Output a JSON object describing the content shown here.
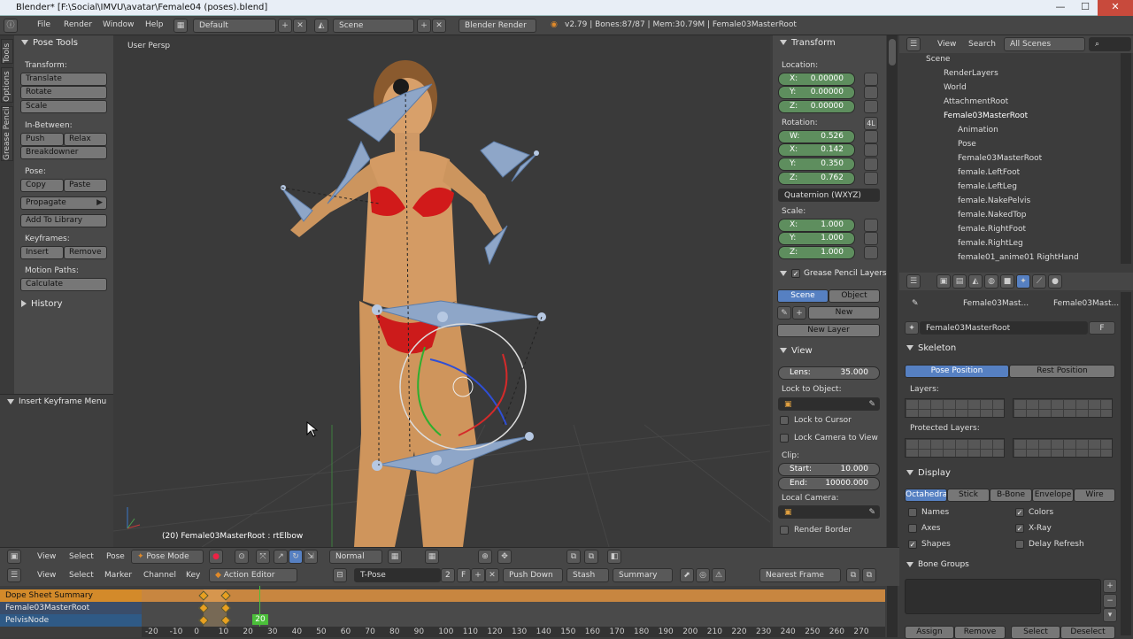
{
  "window": {
    "title": "Blender* [F:\\Social\\IMVU\\avatar\\Female04 (poses).blend]",
    "min": "—",
    "max": "☐",
    "close": "✕"
  },
  "menu": {
    "items": [
      "File",
      "Render",
      "Window",
      "Help"
    ],
    "layout": "Default",
    "scene": "Scene",
    "engine": "Blender Render",
    "stats": "v2.79 | Bones:87/87 | Mem:30.79M | Female03MasterRoot"
  },
  "tool_shelf": {
    "tabs": [
      "Tools",
      "Options",
      "Grease Pencil"
    ],
    "title": "Pose Tools",
    "transform_label": "Transform:",
    "translate": "Translate",
    "rotate": "Rotate",
    "scale": "Scale",
    "inbetween_label": "In-Between:",
    "push": "Push",
    "relax": "Relax",
    "breakdowner": "Breakdowner",
    "pose_label": "Pose:",
    "copy": "Copy",
    "paste": "Paste",
    "propagate": "Propagate",
    "add_to_library": "Add To Library",
    "keyframes_label": "Keyframes:",
    "insert": "Insert",
    "remove": "Remove",
    "motion_paths_label": "Motion Paths:",
    "calculate": "Calculate",
    "history": "History",
    "operator_panel": "Insert Keyframe Menu"
  },
  "viewport": {
    "label": "User Persp",
    "status": "(20) Female03MasterRoot : rtElbow"
  },
  "n_panel": {
    "transform_title": "Transform",
    "location_label": "Location:",
    "location": [
      {
        "k": "X:",
        "v": "0.00000"
      },
      {
        "k": "Y:",
        "v": "0.00000"
      },
      {
        "k": "Z:",
        "v": "0.00000"
      }
    ],
    "rotation_label": "Rotation:",
    "rotation_4l": "4L",
    "rotation": [
      {
        "k": "W:",
        "v": "0.526"
      },
      {
        "k": "X:",
        "v": "0.142"
      },
      {
        "k": "Y:",
        "v": "0.350"
      },
      {
        "k": "Z:",
        "v": "0.762"
      }
    ],
    "rotation_mode": "Quaternion (WXYZ)",
    "scale_label": "Scale:",
    "scale": [
      {
        "k": "X:",
        "v": "1.000"
      },
      {
        "k": "Y:",
        "v": "1.000"
      },
      {
        "k": "Z:",
        "v": "1.000"
      }
    ],
    "grease_title": "Grease Pencil Layers",
    "gp_scene": "Scene",
    "gp_object": "Object",
    "gp_new": "New",
    "gp_new_layer": "New Layer",
    "view_title": "View",
    "lens": {
      "k": "Lens:",
      "v": "35.000"
    },
    "lock_to_object": "Lock to Object:",
    "lock_to_cursor": "Lock to Cursor",
    "lock_camera_to_view": "Lock Camera to View",
    "clip_label": "Clip:",
    "clip_start": {
      "k": "Start:",
      "v": "10.000"
    },
    "clip_end": {
      "k": "End:",
      "v": "10000.000"
    },
    "local_camera": "Local Camera:",
    "render_border": "Render Border"
  },
  "outliner": {
    "view": "View",
    "search": "Search",
    "filter": "All Scenes",
    "rows": [
      "Scene",
      "RenderLayers",
      "World",
      "AttachmentRoot",
      "Female03MasterRoot",
      "Animation",
      "Pose",
      "Female03MasterRoot",
      "female.LeftFoot",
      "female.LeftLeg",
      "female.NakePelvis",
      "female.NakedTop",
      "female.RightFoot",
      "female.RightLeg",
      "female01_anime01 RightHand"
    ]
  },
  "properties": {
    "breadcrumb1": "Female03Mast...",
    "breadcrumb2": "Female03Mast...",
    "datablock": "Female03MasterRoot",
    "fake_user": "F",
    "skeleton_title": "Skeleton",
    "pose_position": "Pose Position",
    "rest_position": "Rest Position",
    "layers_label": "Layers:",
    "protected_label": "Protected Layers:",
    "display_title": "Display",
    "display_modes": [
      "Octahedral",
      "Stick",
      "B-Bone",
      "Envelope",
      "Wire"
    ],
    "names": "Names",
    "colors": "Colors",
    "axes": "Axes",
    "xray": "X-Ray",
    "shapes": "Shapes",
    "delay_refresh": "Delay Refresh",
    "bone_groups_title": "Bone Groups",
    "footer": [
      "Assign",
      "Remove",
      "Select",
      "Deselect"
    ]
  },
  "view3d_header": {
    "view": "View",
    "select": "Select",
    "pose": "Pose",
    "mode": "Pose Mode",
    "shading": "Normal"
  },
  "dopesheet": {
    "menus": [
      "View",
      "Select",
      "Marker",
      "Channel",
      "Key"
    ],
    "editor": "Action Editor",
    "action": "T-Pose",
    "users": "2",
    "fake": "F",
    "push_down": "Push Down",
    "stash": "Stash",
    "summary": "Summary",
    "snap": "Nearest Frame",
    "channels": [
      "Dope Sheet Summary",
      "Female03MasterRoot",
      "PelvisNode"
    ],
    "current_frame": "20",
    "ruler": [
      "-20",
      "-10",
      "0",
      "10",
      "20",
      "30",
      "40",
      "50",
      "60",
      "70",
      "80",
      "90",
      "100",
      "110",
      "120",
      "130",
      "140",
      "150",
      "160",
      "170",
      "180",
      "190",
      "200",
      "210",
      "220",
      "230",
      "240",
      "250",
      "260",
      "270"
    ]
  },
  "colors": {
    "accent": "#5680c2",
    "selected_channel": "#d38a2a",
    "number_field": "#5e8e5e",
    "keyframe": "#e8a020"
  }
}
